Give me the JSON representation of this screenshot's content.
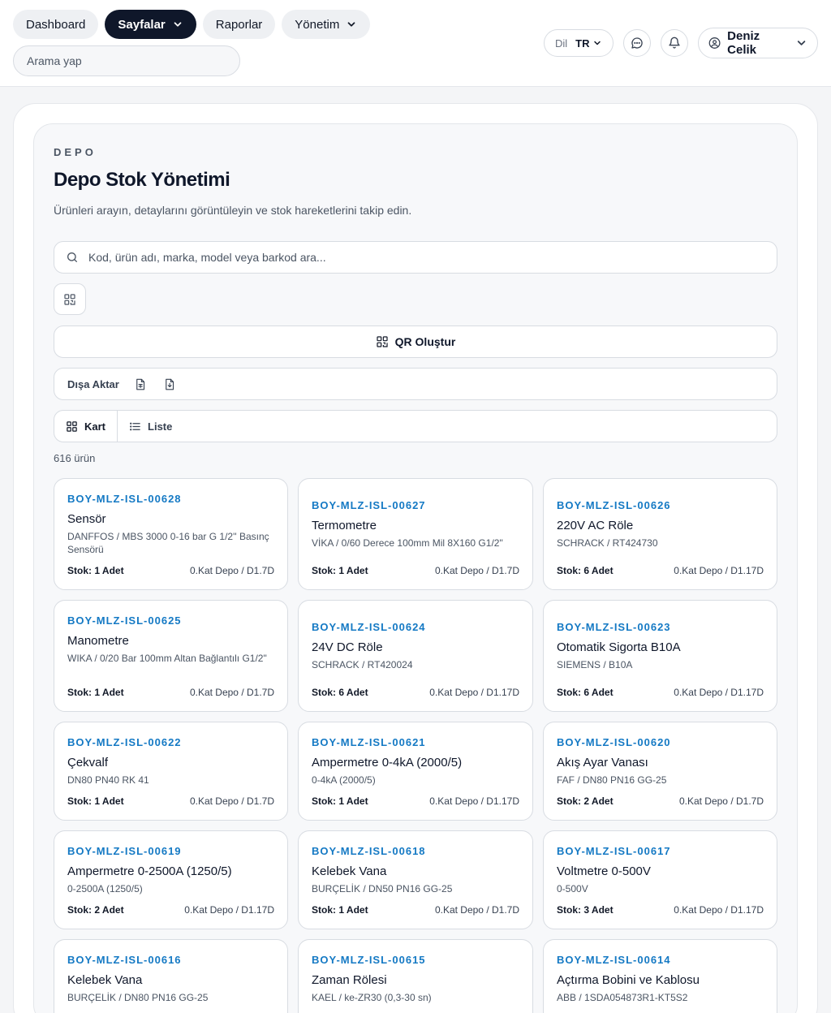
{
  "nav": {
    "items": [
      {
        "label": "Dashboard"
      },
      {
        "label": "Sayfalar"
      },
      {
        "label": "Raporlar"
      },
      {
        "label": "Yönetim"
      }
    ],
    "search_placeholder": "Arama yap"
  },
  "lang": {
    "label": "Dil",
    "value": "TR"
  },
  "user": {
    "name": "Deniz Celik"
  },
  "page": {
    "eyebrow": "DEPO",
    "title": "Depo Stok Yönetimi",
    "subtitle": "Ürünleri arayın, detaylarını görüntüleyin ve stok hareketlerini takip edin.",
    "search_placeholder": "Kod, ürün adı, marka, model veya barkod ara...",
    "qr_label": "QR Oluştur",
    "export_label": "Dışa Aktar",
    "view_card": "Kart",
    "view_list": "Liste",
    "count": "616 ürün"
  },
  "products": [
    {
      "code": "BOY-MLZ-ISL-00628",
      "name": "Sensör",
      "desc": "DANFFOS / MBS 3000 0-16 bar G 1/2'' Basınç Sensörü",
      "stock": "Stok: 1 Adet",
      "loc": "0.Kat Depo / D1.7D"
    },
    {
      "code": "BOY-MLZ-ISL-00627",
      "name": "Termometre",
      "desc": "VİKA / 0/60 Derece 100mm Mil 8X160 G1/2\"",
      "stock": "Stok: 1 Adet",
      "loc": "0.Kat Depo / D1.7D"
    },
    {
      "code": "BOY-MLZ-ISL-00626",
      "name": "220V AC Röle",
      "desc": "SCHRACK / RT424730",
      "stock": "Stok: 6 Adet",
      "loc": "0.Kat Depo / D1.17D"
    },
    {
      "code": "BOY-MLZ-ISL-00625",
      "name": "Manometre",
      "desc": "WIKA / 0/20 Bar 100mm Altan Bağlantılı G1/2\"",
      "stock": "Stok: 1 Adet",
      "loc": "0.Kat Depo / D1.7D"
    },
    {
      "code": "BOY-MLZ-ISL-00624",
      "name": "24V DC Röle",
      "desc": "SCHRACK / RT420024",
      "stock": "Stok: 6 Adet",
      "loc": "0.Kat Depo / D1.17D"
    },
    {
      "code": "BOY-MLZ-ISL-00623",
      "name": "Otomatik Sigorta B10A",
      "desc": "SIEMENS / B10A",
      "stock": "Stok: 6 Adet",
      "loc": "0.Kat Depo / D1.17D"
    },
    {
      "code": "BOY-MLZ-ISL-00622",
      "name": "Çekvalf",
      "desc": "DN80 PN40 RK 41",
      "stock": "Stok: 1 Adet",
      "loc": "0.Kat Depo / D1.7D"
    },
    {
      "code": "BOY-MLZ-ISL-00621",
      "name": "Ampermetre 0-4kA (2000/5)",
      "desc": "0-4kA (2000/5)",
      "stock": "Stok: 1 Adet",
      "loc": "0.Kat Depo / D1.17D"
    },
    {
      "code": "BOY-MLZ-ISL-00620",
      "name": "Akış Ayar Vanası",
      "desc": "FAF / DN80 PN16 GG-25",
      "stock": "Stok: 2 Adet",
      "loc": "0.Kat Depo / D1.7D"
    },
    {
      "code": "BOY-MLZ-ISL-00619",
      "name": "Ampermetre 0-2500A (1250/5)",
      "desc": "0-2500A (1250/5)",
      "stock": "Stok: 2 Adet",
      "loc": "0.Kat Depo / D1.17D"
    },
    {
      "code": "BOY-MLZ-ISL-00618",
      "name": "Kelebek Vana",
      "desc": "BURÇELİK / DN50 PN16 GG-25",
      "stock": "Stok: 1 Adet",
      "loc": "0.Kat Depo / D1.7D"
    },
    {
      "code": "BOY-MLZ-ISL-00617",
      "name": "Voltmetre 0-500V",
      "desc": "0-500V",
      "stock": "Stok: 3 Adet",
      "loc": "0.Kat Depo / D1.17D"
    },
    {
      "code": "BOY-MLZ-ISL-00616",
      "name": "Kelebek Vana",
      "desc": "BURÇELİK / DN80 PN16 GG-25",
      "stock": "",
      "loc": ""
    },
    {
      "code": "BOY-MLZ-ISL-00615",
      "name": "Zaman Rölesi",
      "desc": "KAEL / ke-ZR30 (0,3-30 sn)",
      "stock": "",
      "loc": ""
    },
    {
      "code": "BOY-MLZ-ISL-00614",
      "name": "Açtırma Bobini ve Kablosu",
      "desc": "ABB / 1SDA054873R1-KT5S2",
      "stock": "",
      "loc": ""
    }
  ]
}
